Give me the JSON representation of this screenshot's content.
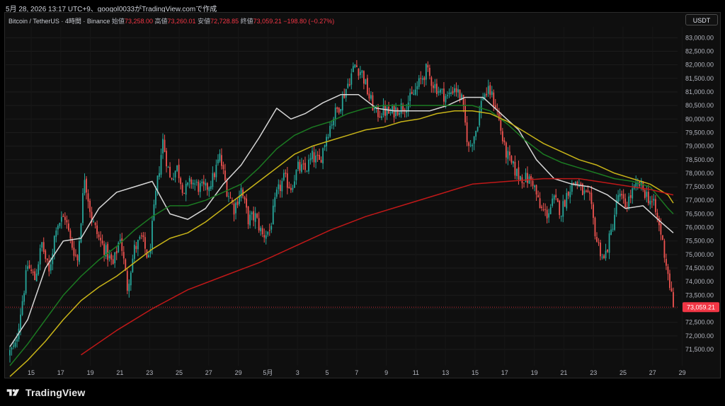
{
  "caption": "5月 28, 2026 13:17 UTC+9、googol0033がTradingView.comで作成",
  "legend": {
    "symbol": "Bitcoin / TetherUS · 4時間 · Binance",
    "open_label": "始値",
    "open": "73,258.00",
    "high_label": "高値",
    "high": "73,260.01",
    "low_label": "安値",
    "low": "72,728.85",
    "close_label": "終値",
    "close": "73,059.21",
    "change": "−198.80 (−0.27%)"
  },
  "currency_button": "USDT",
  "footer": {
    "brand": "TradingView",
    "logo_icon": "tradingview-logo-icon"
  },
  "colors": {
    "background": "#0f0f0f",
    "up": "#26a69a",
    "down": "#ef5350",
    "ma_white": "#d6d6d6",
    "ma_green": "#1b7a22",
    "ma_yellow": "#c8b418",
    "ma_red": "#c01818",
    "price_tag": "#f23645"
  },
  "chart_data": {
    "type": "candlestick",
    "symbol": "Bitcoin / TetherUS",
    "interval": "4時間",
    "exchange": "Binance",
    "ylim": [
      70900,
      83400
    ],
    "y_ticks": [
      "71,500.00",
      "72,000.00",
      "72,500.00",
      "73,000.00",
      "73,500.00",
      "74,000.00",
      "74,500.00",
      "75,000.00",
      "75,500.00",
      "76,000.00",
      "76,500.00",
      "77,000.00",
      "77,500.00",
      "78,000.00",
      "78,500.00",
      "79,000.00",
      "79,500.00",
      "80,000.00",
      "80,500.00",
      "81,000.00",
      "81,500.00",
      "82,000.00",
      "82,500.00",
      "83,000.00"
    ],
    "x_ticks": [
      "15",
      "17",
      "19",
      "21",
      "23",
      "25",
      "27",
      "29",
      "5月",
      "3",
      "5",
      "7",
      "9",
      "11",
      "13",
      "15",
      "17",
      "19",
      "21",
      "23",
      "25",
      "27",
      "29"
    ],
    "last_price": "73,059.21",
    "last_price_value": 73059.21,
    "close_anchors": [
      [
        0,
        71400
      ],
      [
        3,
        71600
      ],
      [
        6,
        72900
      ],
      [
        10,
        74600
      ],
      [
        14,
        74100
      ],
      [
        18,
        75400
      ],
      [
        22,
        74300
      ],
      [
        26,
        76100
      ],
      [
        31,
        76400
      ],
      [
        34,
        75500
      ],
      [
        38,
        74800
      ],
      [
        42,
        77900
      ],
      [
        46,
        76300
      ],
      [
        50,
        75600
      ],
      [
        54,
        75100
      ],
      [
        58,
        74600
      ],
      [
        62,
        75700
      ],
      [
        66,
        73800
      ],
      [
        70,
        75200
      ],
      [
        74,
        75600
      ],
      [
        78,
        74800
      ],
      [
        82,
        77200
      ],
      [
        86,
        79200
      ],
      [
        90,
        77800
      ],
      [
        94,
        78200
      ],
      [
        98,
        77300
      ],
      [
        102,
        77700
      ],
      [
        106,
        77500
      ],
      [
        110,
        77400
      ],
      [
        114,
        77800
      ],
      [
        118,
        78600
      ],
      [
        122,
        77400
      ],
      [
        126,
        76700
      ],
      [
        130,
        77400
      ],
      [
        134,
        76300
      ],
      [
        138,
        76400
      ],
      [
        142,
        75700
      ],
      [
        146,
        75900
      ],
      [
        150,
        77200
      ],
      [
        154,
        77800
      ],
      [
        158,
        77500
      ],
      [
        162,
        78200
      ],
      [
        166,
        78100
      ],
      [
        170,
        78600
      ],
      [
        174,
        78400
      ],
      [
        178,
        79400
      ],
      [
        182,
        80100
      ],
      [
        186,
        80600
      ],
      [
        190,
        81300
      ],
      [
        194,
        82000
      ],
      [
        198,
        81700
      ],
      [
        202,
        80800
      ],
      [
        206,
        80200
      ],
      [
        210,
        80300
      ],
      [
        214,
        80200
      ],
      [
        218,
        80400
      ],
      [
        222,
        80500
      ],
      [
        226,
        80800
      ],
      [
        230,
        81300
      ],
      [
        234,
        81800
      ],
      [
        238,
        81300
      ],
      [
        242,
        81000
      ],
      [
        246,
        80800
      ],
      [
        250,
        81200
      ],
      [
        254,
        80700
      ],
      [
        258,
        78900
      ],
      [
        262,
        79600
      ],
      [
        266,
        80900
      ],
      [
        270,
        81000
      ],
      [
        274,
        80300
      ],
      [
        278,
        78900
      ],
      [
        282,
        78300
      ],
      [
        286,
        77900
      ],
      [
        290,
        77800
      ],
      [
        294,
        77700
      ],
      [
        298,
        76700
      ],
      [
        302,
        76500
      ],
      [
        306,
        77000
      ],
      [
        310,
        76600
      ],
      [
        314,
        77400
      ],
      [
        318,
        77700
      ],
      [
        322,
        77300
      ],
      [
        326,
        77000
      ],
      [
        330,
        75500
      ],
      [
        334,
        74800
      ],
      [
        338,
        75800
      ],
      [
        342,
        77200
      ],
      [
        346,
        76800
      ],
      [
        350,
        77300
      ],
      [
        354,
        77600
      ],
      [
        358,
        77200
      ],
      [
        362,
        76800
      ],
      [
        366,
        75800
      ],
      [
        370,
        74300
      ],
      [
        373,
        73059
      ]
    ],
    "moving_averages": [
      {
        "color": "#d6d6d6",
        "points": [
          [
            0,
            71600
          ],
          [
            10,
            72600
          ],
          [
            20,
            74500
          ],
          [
            30,
            75500
          ],
          [
            40,
            75600
          ],
          [
            50,
            76700
          ],
          [
            60,
            77300
          ],
          [
            70,
            77500
          ],
          [
            80,
            77700
          ],
          [
            90,
            76500
          ],
          [
            100,
            76300
          ],
          [
            110,
            76700
          ],
          [
            120,
            77600
          ],
          [
            130,
            78300
          ],
          [
            140,
            79300
          ],
          [
            150,
            80400
          ],
          [
            158,
            80000
          ],
          [
            166,
            80200
          ],
          [
            176,
            80600
          ],
          [
            186,
            80900
          ],
          [
            196,
            80900
          ],
          [
            206,
            80400
          ],
          [
            216,
            80300
          ],
          [
            226,
            80300
          ],
          [
            236,
            80300
          ],
          [
            246,
            80500
          ],
          [
            256,
            80800
          ],
          [
            266,
            80800
          ],
          [
            276,
            80200
          ],
          [
            286,
            79600
          ],
          [
            296,
            78500
          ],
          [
            306,
            77800
          ],
          [
            316,
            77600
          ],
          [
            326,
            77500
          ],
          [
            336,
            77200
          ],
          [
            346,
            76700
          ],
          [
            356,
            76800
          ],
          [
            366,
            76200
          ],
          [
            373,
            75800
          ]
        ]
      },
      {
        "color": "#1b7a22",
        "points": [
          [
            0,
            70900
          ],
          [
            10,
            71700
          ],
          [
            20,
            72600
          ],
          [
            30,
            73500
          ],
          [
            40,
            74200
          ],
          [
            50,
            74800
          ],
          [
            60,
            75300
          ],
          [
            70,
            75900
          ],
          [
            80,
            76400
          ],
          [
            90,
            76800
          ],
          [
            100,
            76800
          ],
          [
            110,
            77000
          ],
          [
            120,
            77300
          ],
          [
            130,
            77600
          ],
          [
            140,
            78200
          ],
          [
            150,
            78900
          ],
          [
            160,
            79400
          ],
          [
            170,
            79700
          ],
          [
            180,
            79900
          ],
          [
            190,
            80200
          ],
          [
            200,
            80400
          ],
          [
            210,
            80500
          ],
          [
            220,
            80500
          ],
          [
            230,
            80500
          ],
          [
            240,
            80500
          ],
          [
            250,
            80500
          ],
          [
            260,
            80500
          ],
          [
            270,
            80300
          ],
          [
            280,
            79800
          ],
          [
            290,
            79200
          ],
          [
            300,
            78700
          ],
          [
            310,
            78400
          ],
          [
            320,
            78200
          ],
          [
            330,
            78000
          ],
          [
            340,
            77800
          ],
          [
            350,
            77700
          ],
          [
            360,
            77500
          ],
          [
            370,
            76700
          ],
          [
            373,
            76500
          ]
        ]
      },
      {
        "color": "#c8b418",
        "points": [
          [
            0,
            70500
          ],
          [
            10,
            71100
          ],
          [
            20,
            71800
          ],
          [
            30,
            72600
          ],
          [
            40,
            73300
          ],
          [
            50,
            73800
          ],
          [
            60,
            74200
          ],
          [
            70,
            74700
          ],
          [
            80,
            75200
          ],
          [
            90,
            75600
          ],
          [
            100,
            75800
          ],
          [
            110,
            76200
          ],
          [
            120,
            76700
          ],
          [
            130,
            77200
          ],
          [
            140,
            77700
          ],
          [
            150,
            78200
          ],
          [
            160,
            78700
          ],
          [
            170,
            79000
          ],
          [
            180,
            79200
          ],
          [
            190,
            79400
          ],
          [
            200,
            79600
          ],
          [
            210,
            79700
          ],
          [
            220,
            79900
          ],
          [
            230,
            80000
          ],
          [
            240,
            80200
          ],
          [
            250,
            80300
          ],
          [
            260,
            80300
          ],
          [
            270,
            80200
          ],
          [
            280,
            79900
          ],
          [
            290,
            79500
          ],
          [
            300,
            79100
          ],
          [
            310,
            78800
          ],
          [
            320,
            78500
          ],
          [
            330,
            78300
          ],
          [
            340,
            78000
          ],
          [
            350,
            77800
          ],
          [
            360,
            77600
          ],
          [
            370,
            77200
          ],
          [
            373,
            76900
          ]
        ]
      },
      {
        "color": "#c01818",
        "points": [
          [
            40,
            71300
          ],
          [
            60,
            72200
          ],
          [
            80,
            73000
          ],
          [
            100,
            73700
          ],
          [
            120,
            74200
          ],
          [
            140,
            74700
          ],
          [
            160,
            75300
          ],
          [
            180,
            75900
          ],
          [
            200,
            76400
          ],
          [
            220,
            76800
          ],
          [
            240,
            77200
          ],
          [
            260,
            77600
          ],
          [
            280,
            77700
          ],
          [
            300,
            77800
          ],
          [
            320,
            77800
          ],
          [
            340,
            77600
          ],
          [
            360,
            77400
          ],
          [
            373,
            77200
          ]
        ]
      }
    ]
  }
}
